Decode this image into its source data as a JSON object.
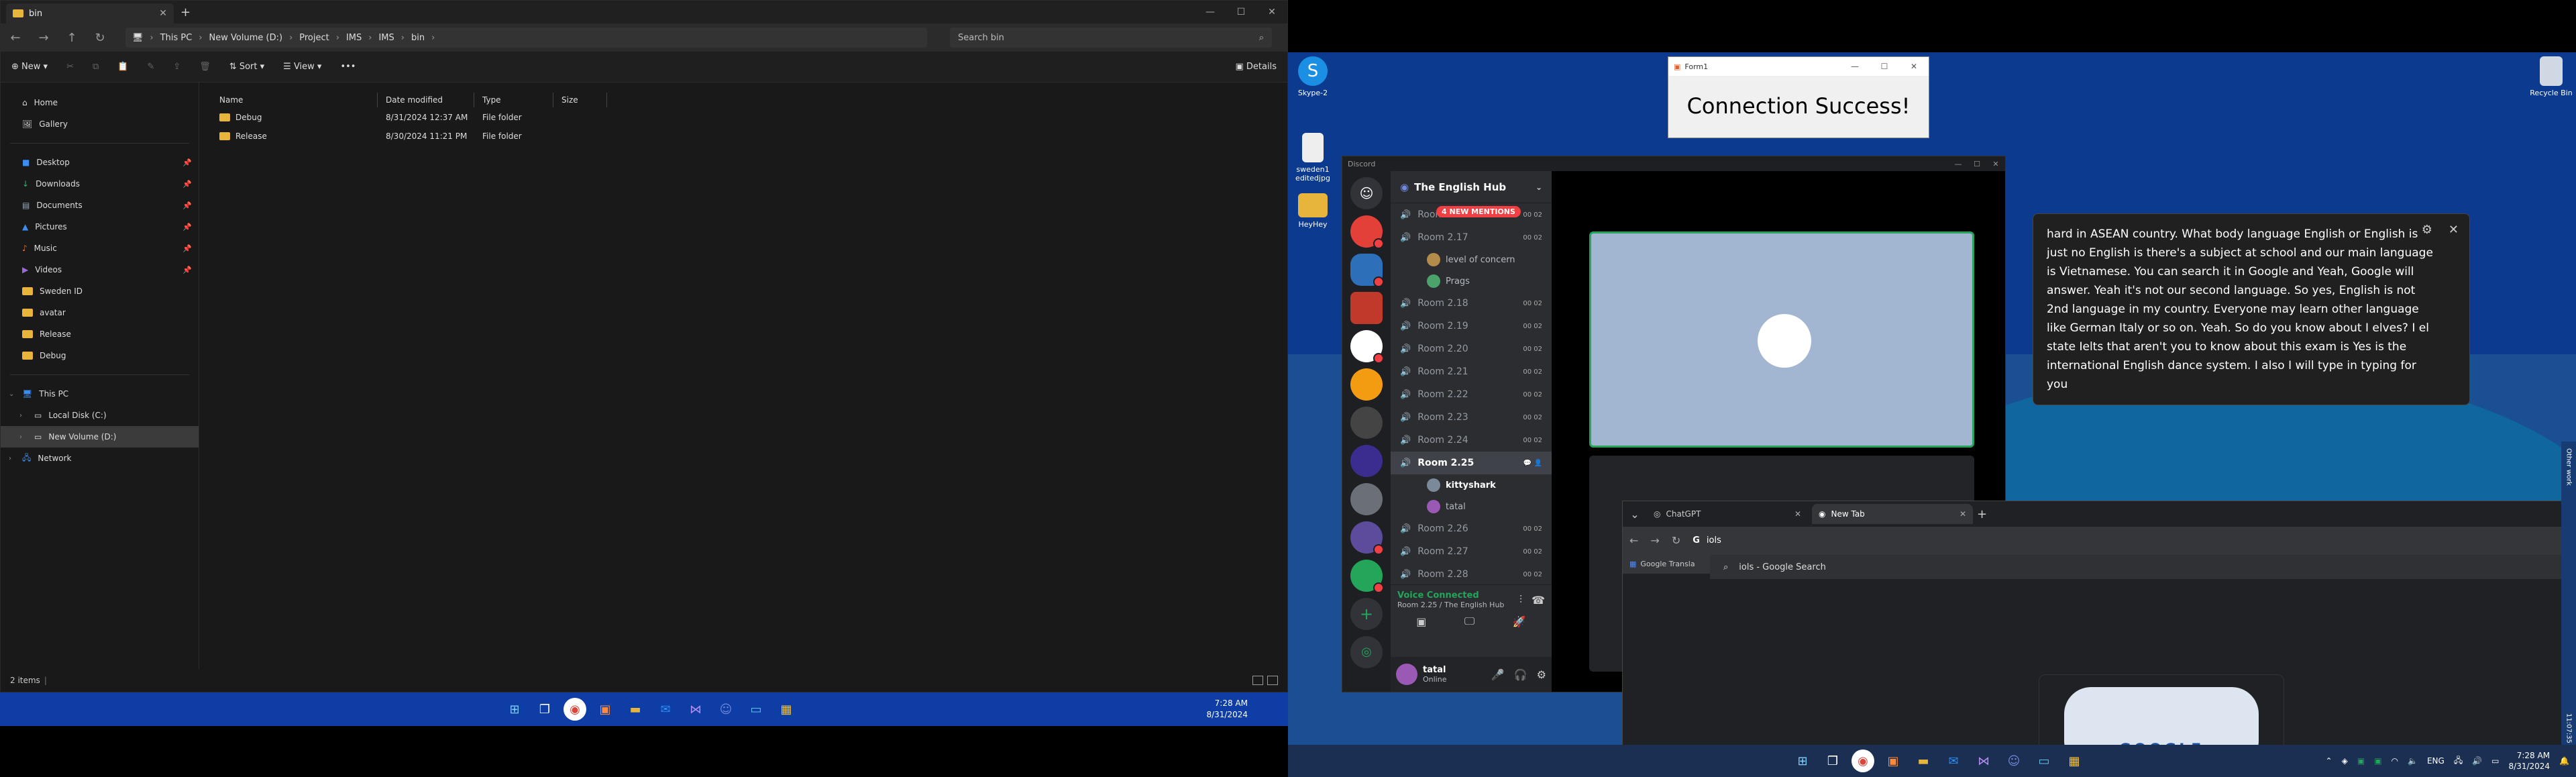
{
  "explorer": {
    "tab_title": "bin",
    "breadcrumb": [
      "This PC",
      "New Volume (D:)",
      "Project",
      "IMS",
      "IMS",
      "bin"
    ],
    "search_placeholder": "Search bin",
    "toolbar": {
      "new": "New",
      "sort": "Sort",
      "view": "View",
      "details": "Details"
    },
    "nav": {
      "home": "Home",
      "gallery": "Gallery",
      "pinned": [
        "Desktop",
        "Downloads",
        "Documents",
        "Pictures",
        "Music",
        "Videos"
      ],
      "folders": [
        "Sweden ID",
        "avatar",
        "Release",
        "Debug"
      ],
      "this_pc": "This PC",
      "local_disk": "Local Disk (C:)",
      "new_volume": "New Volume (D:)",
      "network": "Network"
    },
    "columns": [
      "Name",
      "Date modified",
      "Type",
      "Size"
    ],
    "files": [
      {
        "name": "Debug",
        "date": "8/31/2024 12:37 AM",
        "type": "File folder",
        "size": ""
      },
      {
        "name": "Release",
        "date": "8/30/2024 11:21 PM",
        "type": "File folder",
        "size": ""
      }
    ],
    "status": "2 items",
    "status_sep": "|"
  },
  "taskbar_left": {
    "time": "7:28 AM",
    "date": "8/31/2024"
  },
  "desktop": {
    "icons": [
      {
        "label": "Skype-2",
        "color": "#1a8fe3"
      },
      {
        "label": "sweden1 editedjpg",
        "color": "#eeeeee"
      },
      {
        "label": "HeyHey",
        "color": "#e8b53c"
      },
      {
        "label": "Recycle Bin",
        "color": "#cfd8e3"
      }
    ]
  },
  "form1": {
    "title": "Form1",
    "message": "Connection Success!"
  },
  "discord": {
    "title": "Discord",
    "server_name": "The English Hub",
    "mentions_pill": "4 NEW MENTIONS",
    "channels": [
      {
        "name": "Room",
        "count": "00  02"
      },
      {
        "name": "Room 2.17",
        "count": "00  02"
      },
      {
        "name": "Room 2.18",
        "count": "00  02"
      },
      {
        "name": "Room 2.19",
        "count": "00  02"
      },
      {
        "name": "Room 2.20",
        "count": "00  02"
      },
      {
        "name": "Room 2.21",
        "count": "00  02"
      },
      {
        "name": "Room 2.22",
        "count": "00  02"
      },
      {
        "name": "Room 2.23",
        "count": "00  02"
      },
      {
        "name": "Room 2.24",
        "count": "00  02"
      },
      {
        "name": "Room 2.25",
        "count": ""
      },
      {
        "name": "Room 2.26",
        "count": "00  02"
      },
      {
        "name": "Room 2.27",
        "count": "00  02"
      },
      {
        "name": "Room 2.28",
        "count": "00  02"
      }
    ],
    "users_217": [
      "level of concern",
      "Prags"
    ],
    "users_225": [
      "kittyshark",
      "tatal"
    ],
    "voice_status": "Voice Connected",
    "voice_sub": "Room 2.25 / The English Hub",
    "user_name": "tatal",
    "user_status": "Online"
  },
  "captions": {
    "text": "hard in ASEAN country. What body language English or English is just no English is there's a subject at school and our main language is Vietnamese. You can search it in Google and Yeah, Google will answer. Yeah it's not our second language. So yes, English is not 2nd language in my country. Everyone may learn other language like German Italy or so on. Yeah. So do you know about I elves? I el state Ielts that aren't you to know about this exam is Yes is the international English dance system. I also I will type in typing for you"
  },
  "chrome": {
    "tabs": [
      {
        "title": "ChatGPT",
        "active": false
      },
      {
        "title": "New Tab",
        "active": true
      }
    ],
    "omnibox_value": "iols",
    "bookmark": "Google Transla",
    "suggestion": "iols - Google Search",
    "doodle_text": "GOOGLE"
  },
  "right_strip": {
    "top_label": "Other work",
    "bottom_label": "11:07:35"
  },
  "taskbar_right": {
    "language": "ENG",
    "time": "7:28 AM",
    "date": "8/31/2024"
  },
  "colors": {
    "accent_blue": "#0e3da6",
    "discord_green": "#23a55a",
    "discord_red": "#f23f43",
    "folder_yellow": "#e8b53c"
  }
}
